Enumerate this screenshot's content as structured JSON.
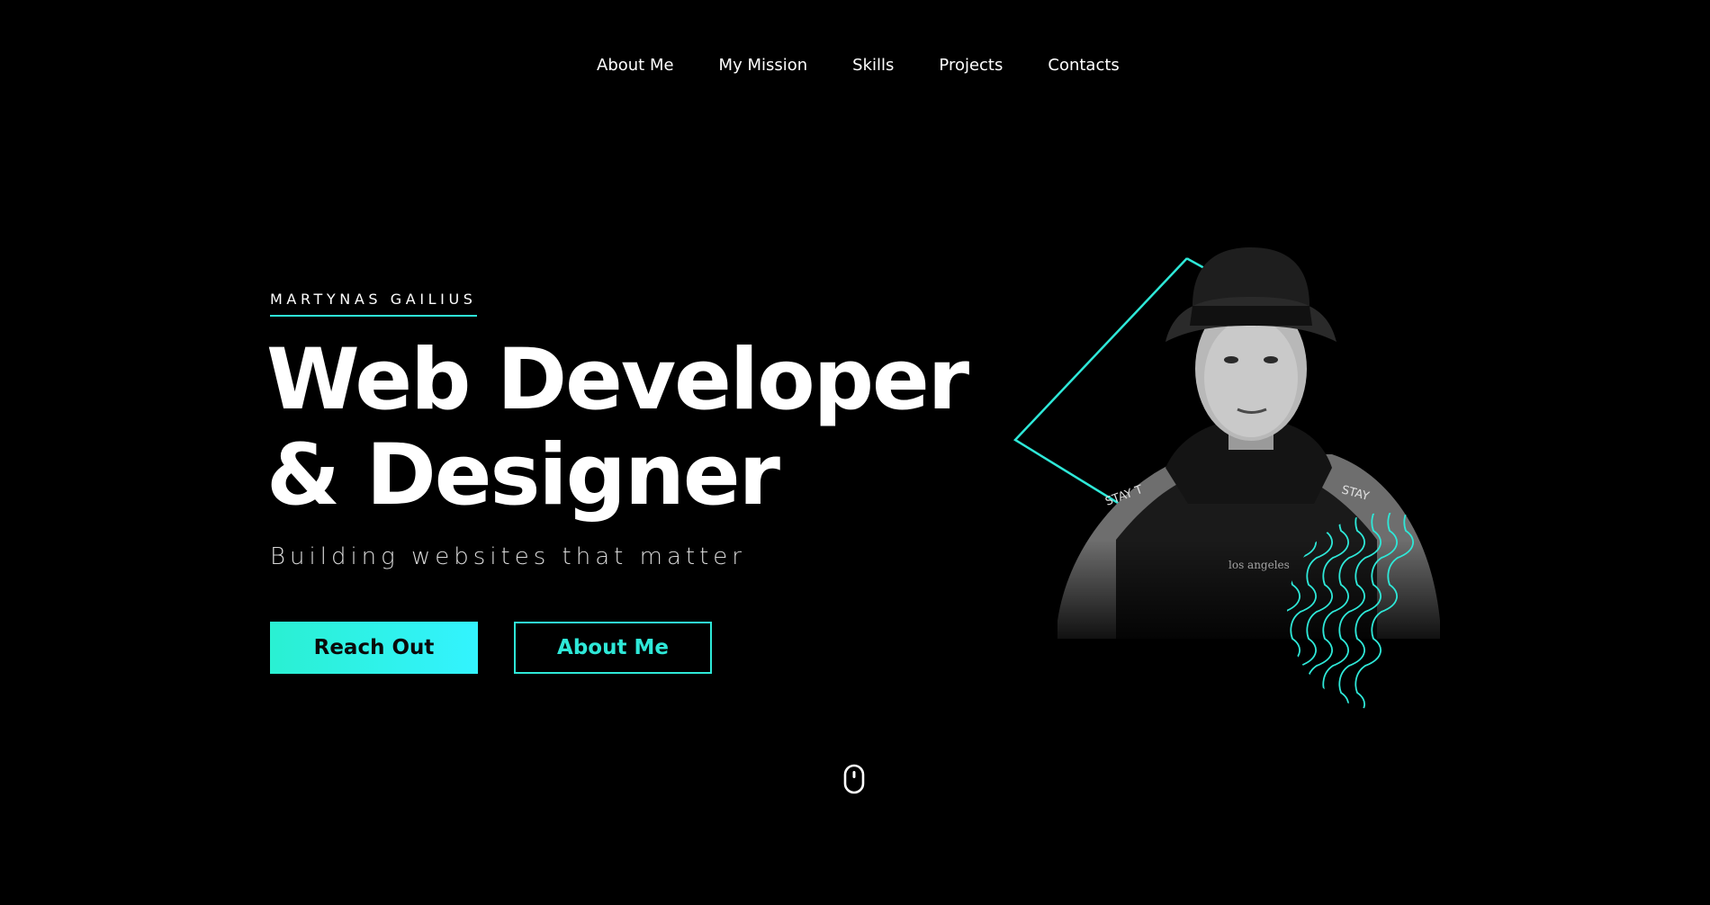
{
  "nav": {
    "items": [
      {
        "label": "About Me"
      },
      {
        "label": "My Mission"
      },
      {
        "label": "Skills"
      },
      {
        "label": "Projects"
      },
      {
        "label": "Contacts"
      }
    ]
  },
  "hero": {
    "eyebrow": "MARTYNAS GAILIUS",
    "headline_line1": "Web Developer",
    "headline_line2": "& Designer",
    "tagline": "Building websites that matter",
    "primary_button": "Reach Out",
    "secondary_button": "About Me"
  },
  "colors": {
    "background": "#000000",
    "accent": "#2ee8d8",
    "accent_gradient_end": "#33f3ff",
    "text": "#ffffff"
  },
  "icons": {
    "scroll": "mouse-scroll-icon"
  }
}
